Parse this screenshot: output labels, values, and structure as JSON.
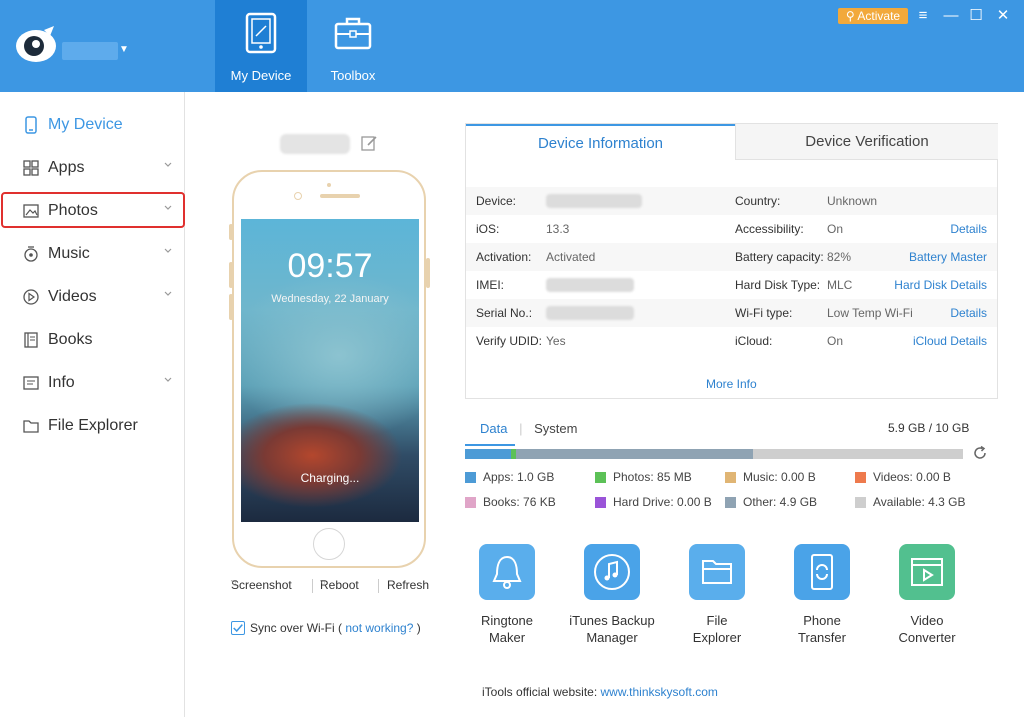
{
  "header": {
    "nav_tabs": [
      {
        "label": "My Device",
        "icon": "tablet-icon"
      },
      {
        "label": "Toolbox",
        "icon": "toolbox-icon"
      }
    ],
    "activate_label": "Activate",
    "window_controls": {
      "menu": "≡",
      "minimize": "—",
      "maximize": "☐",
      "close": "✕"
    }
  },
  "sidebar": {
    "items": [
      {
        "label": "My Device",
        "icon": "phone-icon"
      },
      {
        "label": "Apps",
        "icon": "apps-icon"
      },
      {
        "label": "Photos",
        "icon": "photo-icon"
      },
      {
        "label": "Music",
        "icon": "music-icon"
      },
      {
        "label": "Videos",
        "icon": "video-icon"
      },
      {
        "label": "Books",
        "icon": "book-icon"
      },
      {
        "label": "Info",
        "icon": "info-icon"
      },
      {
        "label": "File Explorer",
        "icon": "folder-icon"
      }
    ]
  },
  "device": {
    "time": "09:57",
    "date": "Wednesday, 22 January",
    "charging": "Charging...",
    "actions": {
      "screenshot": "Screenshot",
      "reboot": "Reboot",
      "refresh": "Refresh"
    },
    "sync": {
      "label": "Sync over Wi-Fi (",
      "link": "not working?",
      "close": ")",
      "checked": true
    }
  },
  "info": {
    "tabs": {
      "device_information": "Device Information",
      "device_verification": "Device Verification"
    },
    "left": [
      {
        "label": "Device:",
        "value": ""
      },
      {
        "label": "iOS:",
        "value": "13.3"
      },
      {
        "label": "Activation:",
        "value": "Activated"
      },
      {
        "label": "IMEI:",
        "value": ""
      },
      {
        "label": "Serial No.:",
        "value": ""
      },
      {
        "label": "Verify UDID:",
        "value": "Yes"
      }
    ],
    "right": [
      {
        "label": "Country:",
        "value": "Unknown",
        "link": ""
      },
      {
        "label": "Accessibility:",
        "value": "On",
        "link": "Details"
      },
      {
        "label": "Battery capacity:",
        "value": "82%",
        "link": "Battery Master"
      },
      {
        "label": "Hard Disk Type:",
        "value": "MLC",
        "link": "Hard Disk Details"
      },
      {
        "label": "Wi-Fi type:",
        "value": "Low Temp Wi-Fi",
        "link": "Details"
      },
      {
        "label": "iCloud:",
        "value": "On",
        "link": "iCloud Details"
      }
    ],
    "more_info": "More Info"
  },
  "storage": {
    "tabs": {
      "data": "Data",
      "system": "System"
    },
    "total": "5.9 GB / 10 GB",
    "used_fraction": 0.59,
    "legend": [
      {
        "label": "Apps: 1.0 GB",
        "color": "#4d9bd6"
      },
      {
        "label": "Photos: 85 MB",
        "color": "#5cc157"
      },
      {
        "label": "Music: 0.00 B",
        "color": "#e0b574"
      },
      {
        "label": "Videos: 0.00 B",
        "color": "#ee7a4d"
      },
      {
        "label": "Books: 76 KB",
        "color": "#e0a5c8"
      },
      {
        "label": "Hard Drive: 0.00 B",
        "color": "#9a54d8"
      },
      {
        "label": "Other: 4.9 GB",
        "color": "#8fa3b3"
      },
      {
        "label": "Available: 4.3 GB",
        "color": "#cecece"
      }
    ]
  },
  "tools": [
    {
      "label_line1": "Ringtone",
      "label_line2": "Maker",
      "icon": "bell-icon",
      "color": "#5aaeec"
    },
    {
      "label_line1": "iTunes Backup",
      "label_line2": "Manager",
      "icon": "music-note-icon",
      "color": "#4aa3e8"
    },
    {
      "label_line1": "File",
      "label_line2": "Explorer",
      "icon": "folder-icon",
      "color": "#5aaeec"
    },
    {
      "label_line1": "Phone",
      "label_line2": "Transfer",
      "icon": "phone-transfer-icon",
      "color": "#4aa3e8"
    },
    {
      "label_line1": "Video",
      "label_line2": "Converter",
      "icon": "video-converter-icon",
      "color": "#52c08f"
    }
  ],
  "footer": {
    "label": "iTools official website: ",
    "link": "www.thinkskysoft.com"
  }
}
